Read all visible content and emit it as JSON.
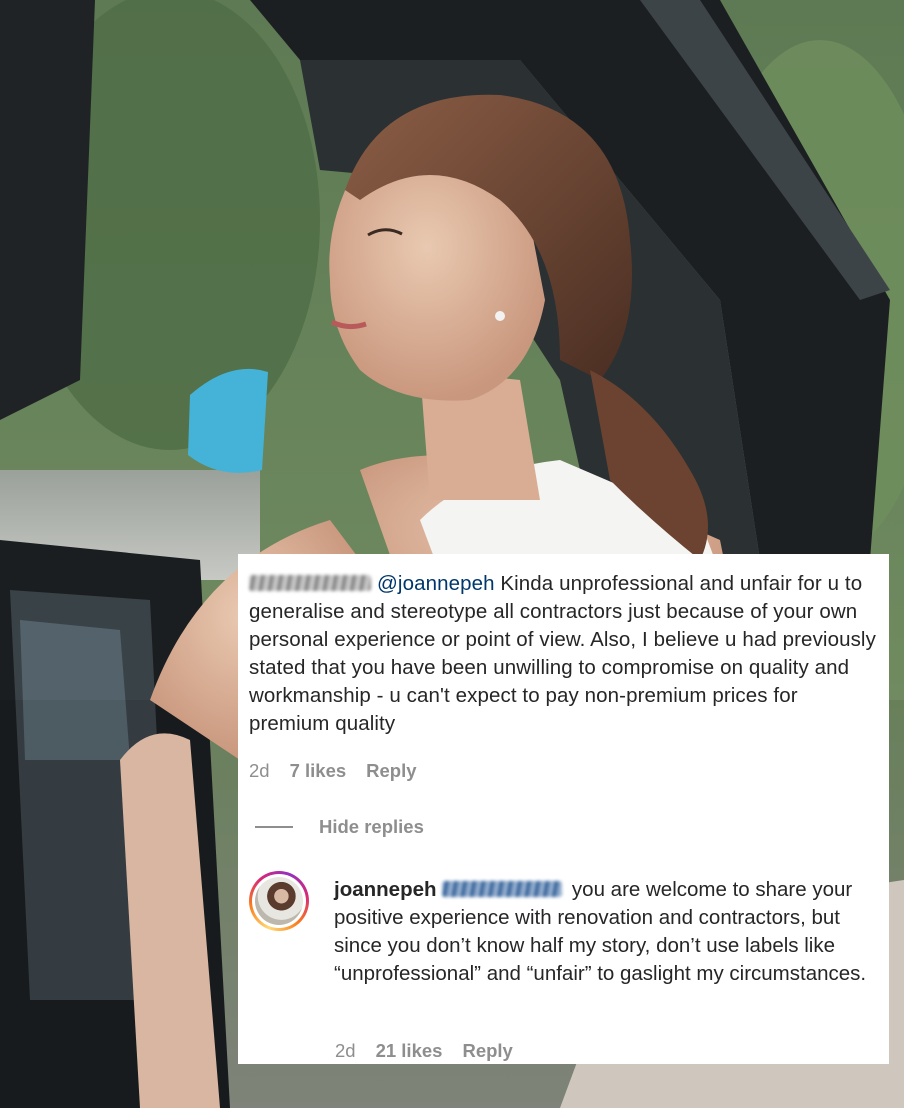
{
  "comment": {
    "username_hidden": "blurred-username",
    "mention": "@joannepeh",
    "text": " Kinda unprofessional and unfair for u to generalise and stereotype all contractors just because of your own personal experience or point of view. Also, I believe u had previously stated that you have been unwilling to compromise on quality and workmanship - u can't expect to pay non-premium prices for premium quality",
    "age": "2d",
    "likes": "7 likes",
    "reply_label": "Reply"
  },
  "hide_replies_label": "Hide replies",
  "reply": {
    "username": "joannepeh",
    "mention_hidden": "blurred-mention",
    "text": " you are welcome to share your positive experience with renovation and contractors, but since you don’t know half my story, don’t use labels like “unprofessional” and “unfair” to gaslight my circumstances.",
    "age": "2d",
    "likes": "21 likes",
    "reply_label": "Reply"
  },
  "colors": {
    "text": "#262626",
    "muted": "#8e8e8e",
    "mention": "#00376b",
    "card_bg": "#ffffff"
  }
}
